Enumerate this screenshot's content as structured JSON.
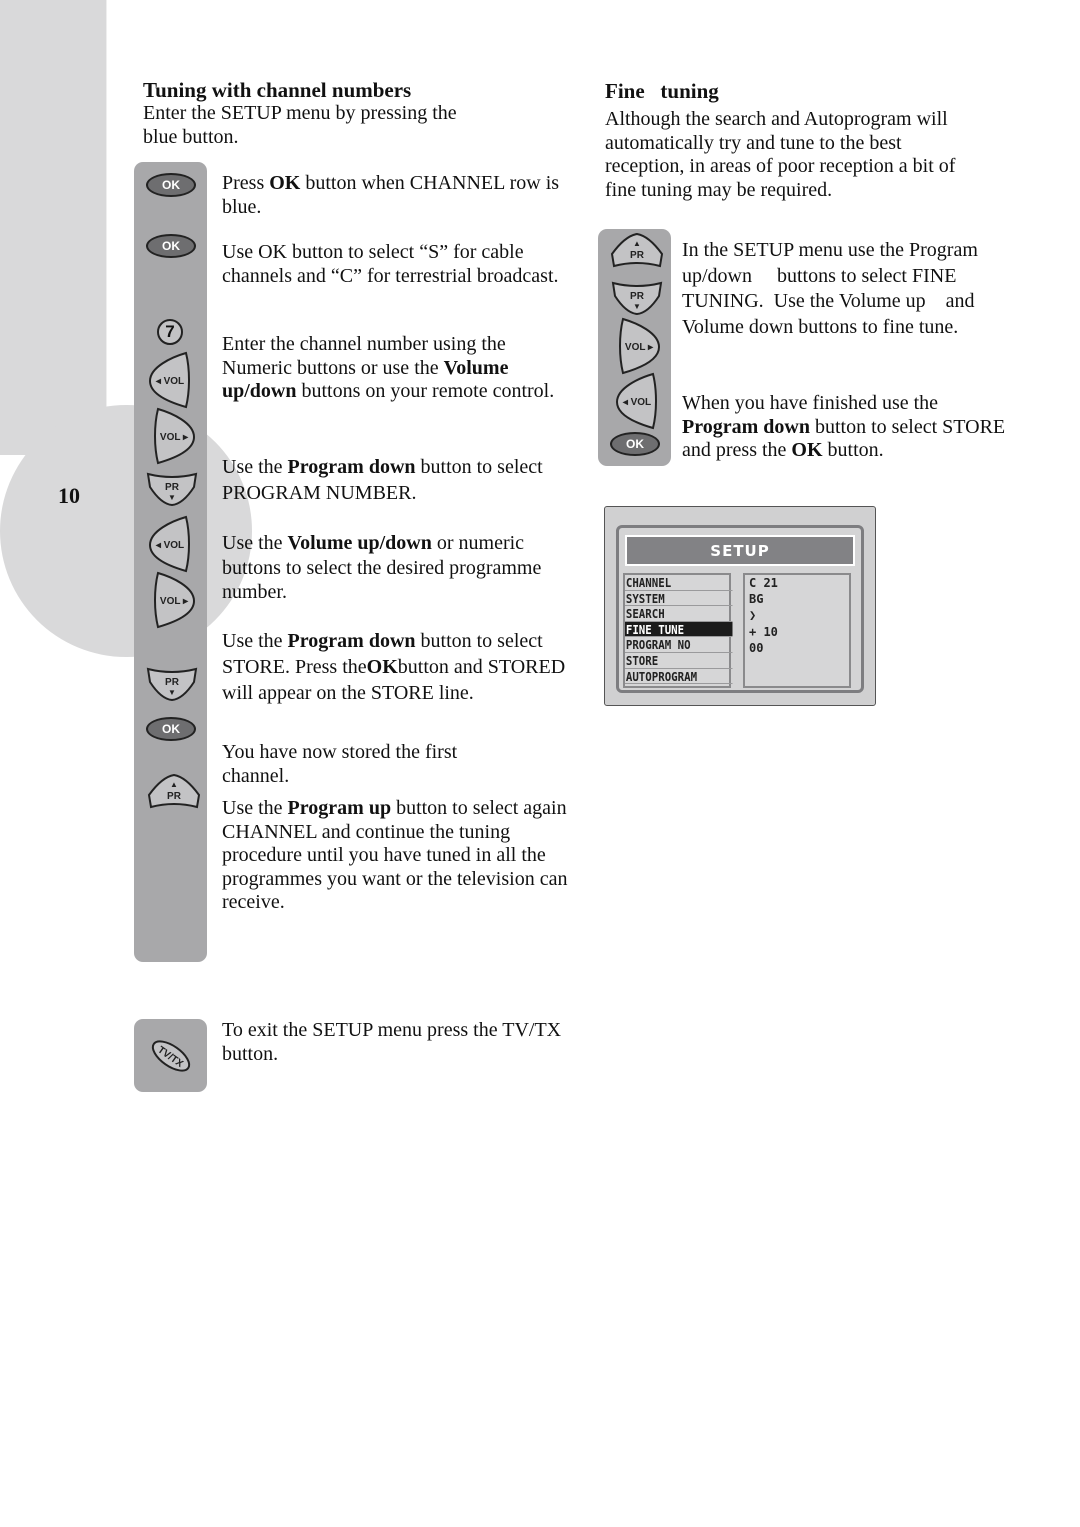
{
  "page": {
    "number": "10"
  },
  "left_section": {
    "title": "Tuning with channel numbers",
    "intro": "Enter the SETUP menu by pressing the blue button.",
    "steps": [
      {
        "parts": [
          {
            "t": "Press "
          },
          {
            "b": "OK"
          },
          {
            "t": " button when CHANNEL row is blue."
          }
        ]
      },
      {
        "parts": [
          {
            "t": "Use OK button to select “S” for cable channels and “C” for terrestrial broadcast."
          }
        ]
      },
      {
        "parts": [
          {
            "t": "Enter the channel number using the Numeric buttons or use the "
          },
          {
            "b": "Volume up/down"
          },
          {
            "t": " buttons on your remote control."
          }
        ]
      },
      {
        "parts": [
          {
            "t": "Use the "
          },
          {
            "b": "Program down"
          },
          {
            "t": "  button to select PROGRAM NUMBER."
          }
        ]
      },
      {
        "parts": [
          {
            "t": "Use the "
          },
          {
            "b": "Volume up/down"
          },
          {
            "t": "   or numeric buttons to select the desired programme number."
          }
        ]
      },
      {
        "parts": [
          {
            "t": "Use the "
          },
          {
            "b": "Program down"
          },
          {
            "t": "  button to select STORE. Press the"
          },
          {
            "b": "OK"
          },
          {
            "t": "button and STORED will appear on the STORE line."
          }
        ]
      },
      {
        "parts": [
          {
            "t": "You have now stored the first channel."
          }
        ]
      },
      {
        "parts": [
          {
            "t": "Use the  "
          },
          {
            "b": "Program up"
          },
          {
            "t": " button to select again CHANNEL and continue the tuning procedure until you have tuned in all the programmes you want or the television can receive."
          }
        ]
      }
    ],
    "exit_text": "To exit the SETUP menu press the TV/TX button."
  },
  "right_section": {
    "title": "Fine   tuning",
    "intro": "Although the search and Autoprogram will automatically try and tune to the best reception, in areas of poor reception a bit of fine tuning may be required.",
    "steps": [
      {
        "parts": [
          {
            "t": "In the SETUP menu use the Program up/down     buttons to select FINE TUNING.  Use the Volume up    and Volume down buttons to fine tune."
          }
        ]
      },
      {
        "parts": [
          {
            "t": "When you have finished use the "
          },
          {
            "b": "Program down"
          },
          {
            "t": " button to select STORE and press the "
          },
          {
            "b": "OK"
          },
          {
            "t": " button."
          }
        ]
      }
    ]
  },
  "buttons": {
    "ok": "OK",
    "seven": "7",
    "vol_left": "◂ VOL",
    "vol_right": "VOL ▸",
    "pr": "PR",
    "tvtx": "TV/TX"
  },
  "setup_menu": {
    "title": "SETUP",
    "items": [
      "CHANNEL",
      "SYSTEM",
      "SEARCH",
      "FINE TUNE",
      "PROGRAM NO",
      "STORE",
      "AUTOPROGRAM"
    ],
    "selected_item": "FINE TUNE",
    "values": [
      "C 21",
      "BG",
      "❯",
      "+ 10",
      "00"
    ]
  },
  "colors": {
    "strip": "#a8a8aa",
    "background_shape": "#d9d9da",
    "menu_selected": "#1b1b1b"
  }
}
